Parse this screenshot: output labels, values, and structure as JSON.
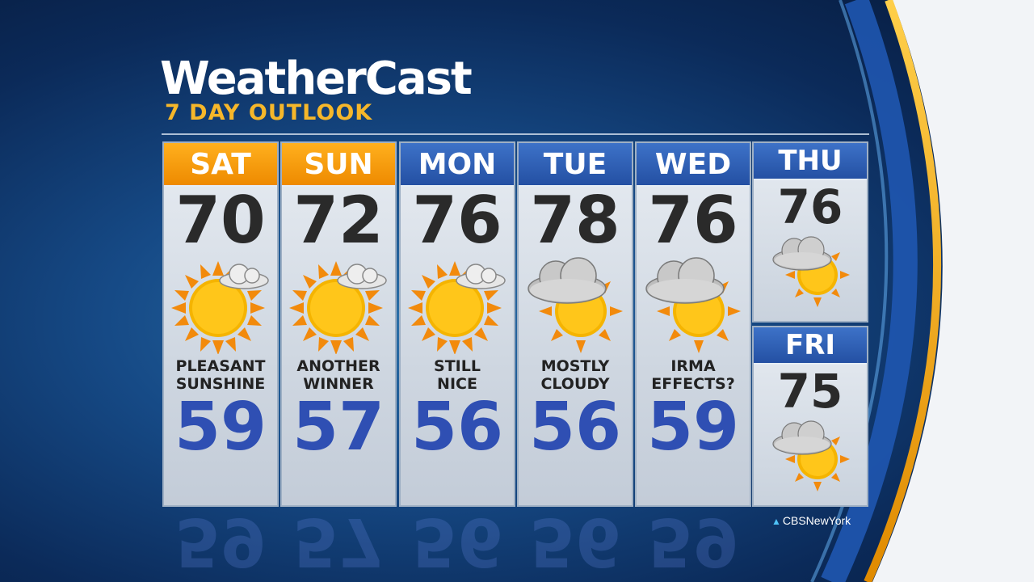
{
  "brand": {
    "title": "WeatherCast",
    "subtitle": "7 DAY OUTLOOK"
  },
  "colors": {
    "accent_orange": "#f6b72a",
    "header_blue": "#2f5fb8",
    "low_blue": "#2f4fb3",
    "high_text": "#2a2a2a"
  },
  "days": [
    {
      "day": "SAT",
      "high": "70",
      "desc1": "PLEASANT",
      "desc2": "SUNSHINE",
      "low": "59",
      "icon": "sun-small-cloud-icon",
      "header": "orange"
    },
    {
      "day": "SUN",
      "high": "72",
      "desc1": "ANOTHER",
      "desc2": "WINNER",
      "low": "57",
      "icon": "sun-small-cloud-icon",
      "header": "orange"
    },
    {
      "day": "MON",
      "high": "76",
      "desc1": "STILL",
      "desc2": "NICE",
      "low": "56",
      "icon": "sun-small-cloud-icon",
      "header": "blue"
    },
    {
      "day": "TUE",
      "high": "78",
      "desc1": "MOSTLY",
      "desc2": "CLOUDY",
      "low": "56",
      "icon": "mostly-cloudy-icon",
      "header": "blue"
    },
    {
      "day": "WED",
      "high": "76",
      "desc1": "IRMA",
      "desc2": "EFFECTS?",
      "low": "59",
      "icon": "mostly-cloudy-icon",
      "header": "blue"
    }
  ],
  "extended": [
    {
      "day": "THU",
      "high": "76",
      "icon": "mostly-cloudy-icon"
    },
    {
      "day": "FRI",
      "high": "75",
      "icon": "mostly-cloudy-icon"
    }
  ],
  "credit": {
    "handle": "CBSNewYork",
    "icon": "twitter-bird-icon"
  }
}
